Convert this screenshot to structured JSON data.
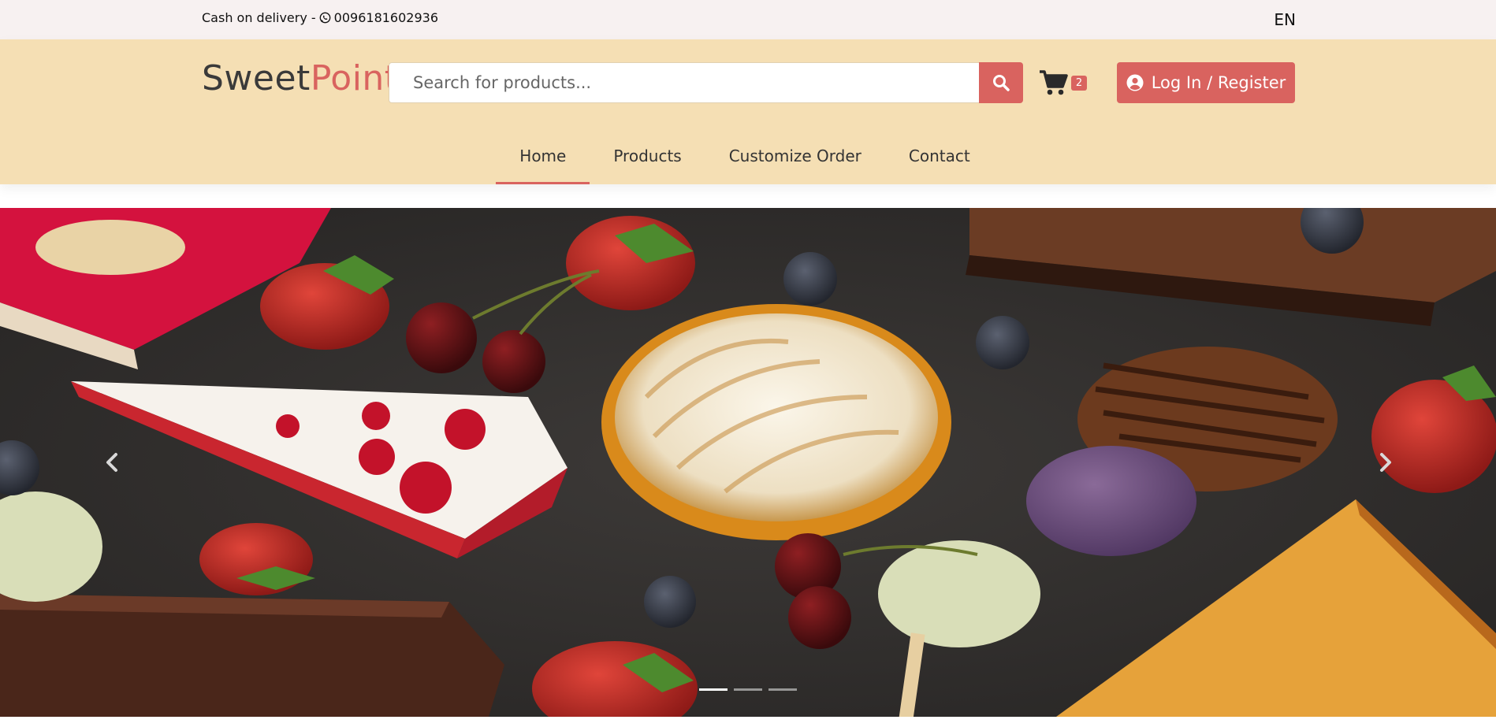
{
  "topbar": {
    "contact_prefix": "Cash on delivery - ",
    "phone": "0096181602936",
    "language": "EN"
  },
  "header": {
    "logo_part1": "Sweet",
    "logo_part2": "Point",
    "search_placeholder": "Search for products...",
    "cart_count": "2",
    "login_label": "Log In / Register"
  },
  "nav": {
    "items": [
      {
        "label": "Home",
        "active": true
      },
      {
        "label": "Products",
        "active": false
      },
      {
        "label": "Customize Order",
        "active": false
      },
      {
        "label": "Contact",
        "active": false
      }
    ]
  },
  "carousel": {
    "slide_count": 3,
    "active_index": 0
  },
  "colors": {
    "accent": "#d9635f",
    "header_bg": "#f5dfb4",
    "topbar_bg": "#f7f1f1"
  }
}
